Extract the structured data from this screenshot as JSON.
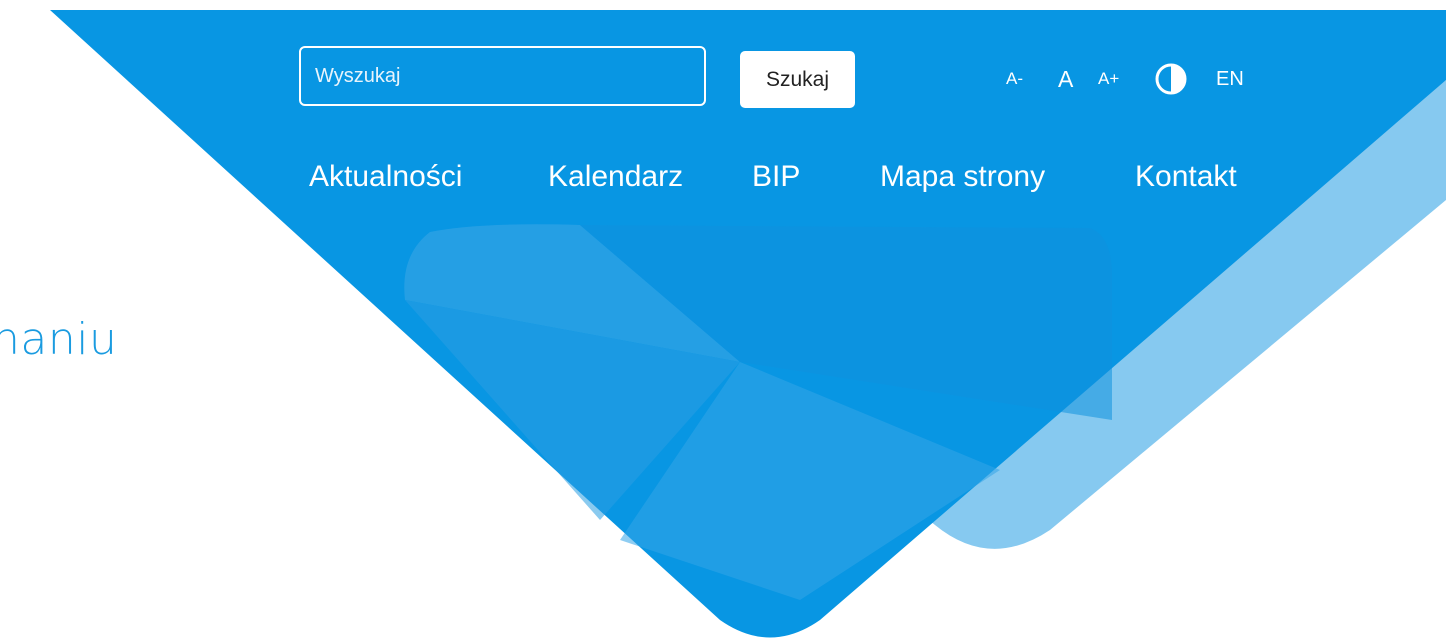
{
  "search": {
    "placeholder": "Wyszukaj",
    "button_label": "Szukaj"
  },
  "accessibility": {
    "font_smaller": "A-",
    "font_normal": "A",
    "font_larger": "A+",
    "contrast_icon": "contrast-icon",
    "language": "EN"
  },
  "nav": {
    "items": [
      {
        "label": "Aktualności"
      },
      {
        "label": "Kalendarz"
      },
      {
        "label": "BIP"
      },
      {
        "label": "Mapa strony"
      },
      {
        "label": "Kontakt"
      }
    ]
  },
  "hero": {
    "text": "naniu"
  },
  "colors": {
    "primary_blue": "#0896e3",
    "light_blue": "#86c9f0",
    "text_blue": "#1a9be0",
    "white": "#ffffff"
  }
}
